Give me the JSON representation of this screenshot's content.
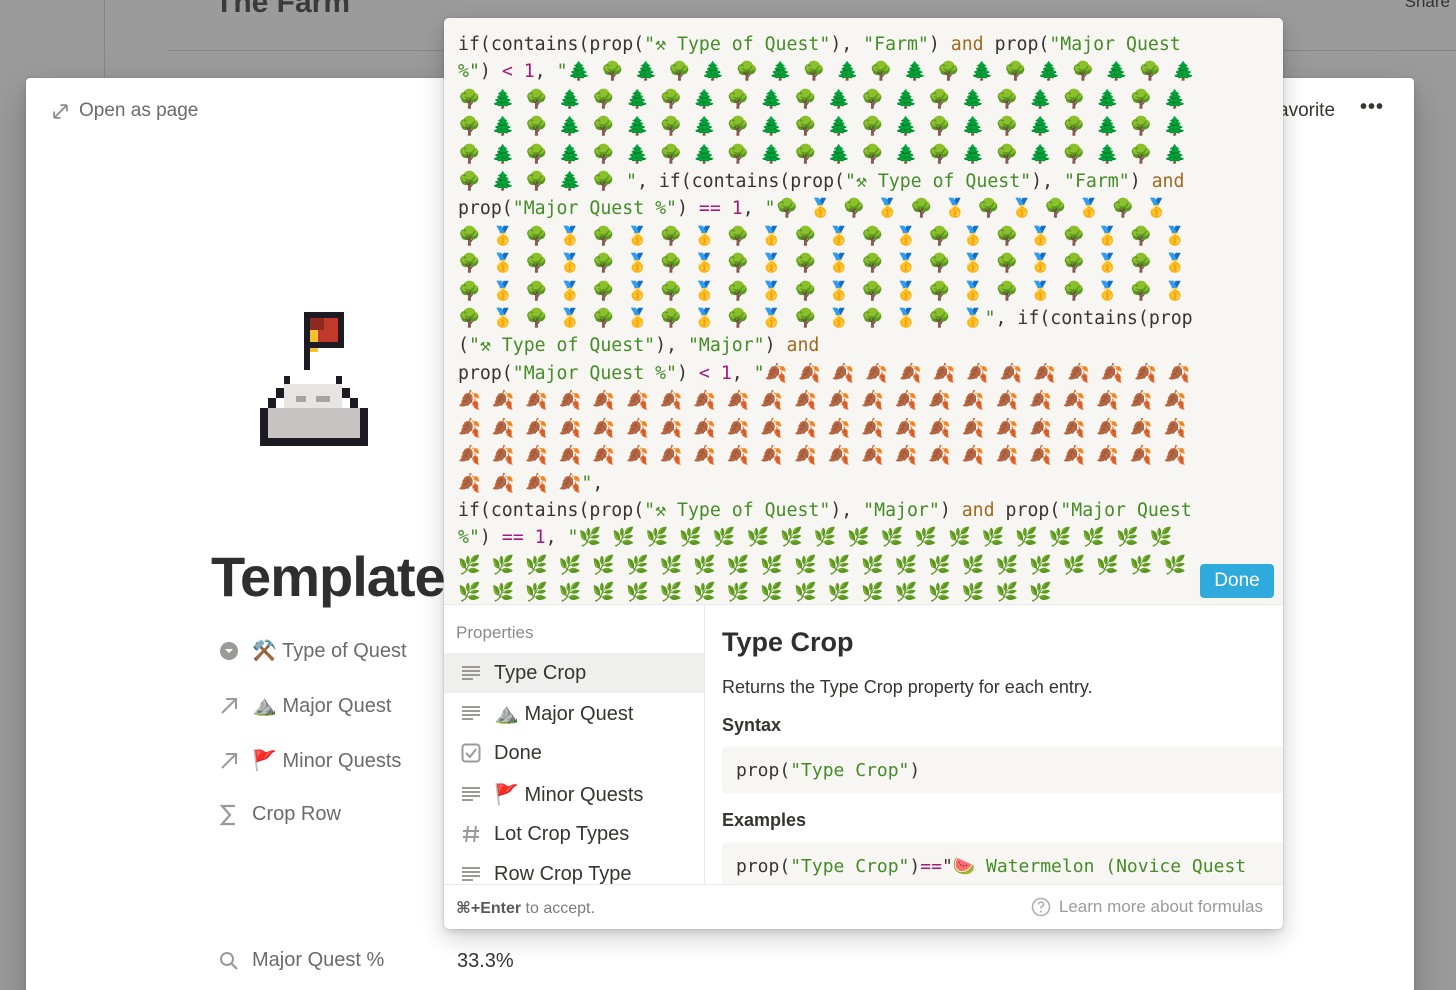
{
  "background": {
    "title": "The Farm",
    "share_label": "Share"
  },
  "peek": {
    "open_as_page": "Open as page",
    "favorite": "avorite",
    "more": "•••",
    "page_icon": "pixel-mountain-flag-icon",
    "title": "Template",
    "properties": [
      {
        "icon": "select-icon",
        "label": "⚒️ Type of Quest"
      },
      {
        "icon": "relation-arrow-icon",
        "label": "⛰️ Major Quest"
      },
      {
        "icon": "relation-arrow-icon",
        "label": "🚩 Minor Quests"
      },
      {
        "icon": "sigma-icon",
        "label": "Crop Row"
      },
      {
        "icon": "search-icon",
        "label": "Major Quest %",
        "value": "33.3%"
      }
    ]
  },
  "formula": {
    "line1_a": "if(contains(prop(",
    "line1_str1": "\"⚒ Type of Quest\"",
    "line1_b": "), ",
    "line1_str2": "\"Farm\"",
    "line1_c": ") ",
    "kw_and": "and",
    "line1_d": " prop(",
    "line1_str3": "\"Major Quest %\"",
    "line1_e": ") ",
    "op_lt": "<",
    "num1": "1",
    "comma": ", ",
    "trees": "\"🌲 🌳 🌲 🌳 🌲 🌳 🌲 🌳 🌲 🌳 🌲 🌳 🌲 🌳 🌲 🌳 🌲 🌳 🌲 🌳 🌲 🌳 🌲 🌳 🌲 🌳 🌲 🌳 🌲 🌳 🌲 🌳 🌲 🌳 🌲 🌳 🌲 🌳 🌲 🌳 🌲 🌳 🌲 🌳 🌲 🌳 🌲 🌳 🌲 🌳 🌲 🌳 🌲 🌳 🌲 🌳 🌲 🌳 🌲 🌳 🌲 🌳 🌲 🌳 🌲 🌳 🌲 🌳 🌲 🌳 🌲 🌳 🌲 🌳 🌲 🌳 🌲 🌳 🌲 🌳 🌲 🌳 🌲 🌳 🌲 🌳 🌲 🌳 🌲 🌳 \"",
    "line2_a": ", if(contains(prop(",
    "line2_str1": "\"⚒ Type of Quest\"",
    "line2_b": "), ",
    "line2_str2": "\"Farm\"",
    "line2_c": ") ",
    "line2_d": " prop(",
    "line2_str3": "\"Major Quest %\"",
    "line2_e": ") ",
    "op_eq": "==",
    "num2": "1",
    "medals": "\"🌳 🥇 🌳 🥇 🌳 🥇 🌳 🥇 🌳 🥇 🌳 🥇 🌳 🥇 🌳 🥇 🌳 🥇 🌳 🥇 🌳 🥇 🌳 🥇 🌳 🥇 🌳 🥇 🌳 🥇 🌳 🥇 🌳 🥇 🌳 🥇 🌳 🥇 🌳 🥇 🌳 🥇 🌳 🥇 🌳 🥇 🌳 🥇 🌳 🥇 🌳 🥇 🌳 🥇 🌳 🥇 🌳 🥇 🌳 🥇 🌳 🥇 🌳 🥇 🌳 🥇 🌳 🥇 🌳 🥇 🌳 🥇 🌳 🥇 🌳 🥇 🌳 🥇 🌳 🥇 🌳 🥇 🌳 🥇 🌳 🥇 🌳 🥇 🌳 🥇 🌳 🥇 🌳 🥇\"",
    "line3_a": ", if(contains(prop(",
    "line3_str1": "\"⚒ Type of Quest\"",
    "line3_b": "), ",
    "line3_str2": "\"Major\"",
    "line3_c": ") ",
    "line3_d": "\nprop(",
    "line3_str3": "\"Major Quest %\"",
    "line3_e": ") ",
    "num3": "1",
    "leaves": "\"🍂 🍂 🍂 🍂 🍂 🍂 🍂 🍂 🍂 🍂 🍂 🍂 🍂 🍂 🍂 🍂 🍂 🍂 🍂 🍂 🍂 🍂 🍂 🍂 🍂 🍂 🍂 🍂 🍂 🍂 🍂 🍂 🍂 🍂 🍂 🍂 🍂 🍂 🍂 🍂 🍂 🍂 🍂 🍂 🍂 🍂 🍂 🍂 🍂 🍂 🍂 🍂 🍂 🍂 🍂 🍂 🍂 🍂 🍂 🍂 🍂 🍂 🍂 🍂 🍂 🍂 🍂 🍂 🍂 🍂 🍂 🍂 🍂 🍂 🍂 🍂 🍂 🍂 🍂 🍂 🍂 🍂 🍂\"",
    "line4_a": ",\nif(contains(prop(",
    "line4_str1": "\"⚒ Type of Quest\"",
    "line4_b": "), ",
    "line4_str2": "\"Major\"",
    "line4_c": ") ",
    "line4_d": " prop(",
    "line4_str3": "\"Major Quest %\"",
    "line4_e": ") ",
    "num4": "1",
    "herbs": "\"🌿 🌿 🌿 🌿 🌿 🌿 🌿 🌿 🌿 🌿 🌿 🌿 🌿 🌿 🌿 🌿 🌿 🌿 🌿 🌿 🌿 🌿 🌿 🌿 🌿 🌿 🌿 🌿 🌿 🌿 🌿 🌿 🌿 🌿 🌿 🌿 🌿 🌿 🌿 🌿 🌿 🌿 🌿 🌿 🌿 🌿 🌿 🌿 🌿 🌿 🌿 🌿 🌿 🌿 🌿 🌿 🌿 🌿",
    "done_label": "Done",
    "properties_heading": "Properties",
    "properties": [
      {
        "icon": "text-icon",
        "label": "Type Crop",
        "active": true
      },
      {
        "icon": "text-icon",
        "label": "⛰️ Major Quest"
      },
      {
        "icon": "checkbox-icon",
        "label": "Done"
      },
      {
        "icon": "text-icon",
        "label": "🚩 Minor Quests"
      },
      {
        "icon": "number-icon",
        "label": "Lot Crop Types"
      },
      {
        "icon": "text-icon",
        "label": "Row Crop Type"
      }
    ],
    "detail": {
      "title": "Type Crop",
      "description": "Returns the Type Crop property for each entry.",
      "syntax_heading": "Syntax",
      "syntax_a": "prop(",
      "syntax_str": "\"Type Crop\"",
      "syntax_b": ")",
      "examples_heading": "Examples",
      "example_a": "prop(",
      "example_str": "\"Type Crop\"",
      "example_b": ") ",
      "example_op": "==",
      "example_c": " \"",
      "example_str2": "🍉 Watermelon (Novice Quest"
    },
    "accept_key": "⌘+Enter",
    "accept_text": " to accept.",
    "learn_more": "Learn more about formulas"
  },
  "colors": {
    "accent": "#2eaadc",
    "string": "#448c27",
    "keyword": "#a2681f",
    "number": "#a5197a"
  }
}
